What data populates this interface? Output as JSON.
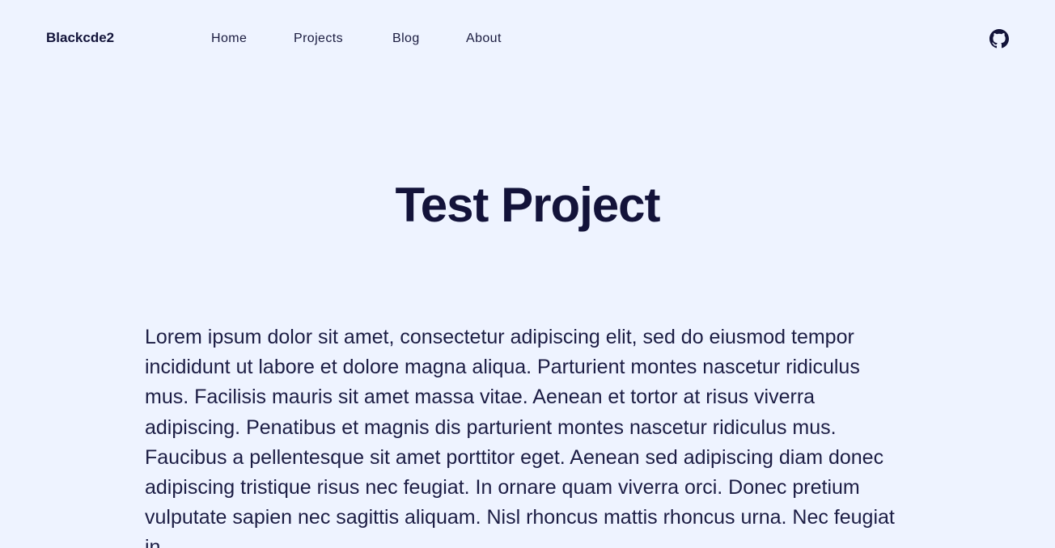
{
  "nav": {
    "brand": "Blackcde2",
    "links": [
      "Home",
      "Projects",
      "Blog",
      "About"
    ],
    "github_icon": "github-icon"
  },
  "page": {
    "title": "Test Project",
    "body": "Lorem ipsum dolor sit amet, consectetur adipiscing elit, sed do eiusmod tempor incididunt ut labore et dolore magna aliqua. Parturient montes nascetur ridiculus mus. Facilisis mauris sit amet massa vitae. Aenean et tortor at risus viverra adipiscing. Penatibus et magnis dis parturient montes nascetur ridiculus mus. Faucibus a pellentesque sit amet porttitor eget. Aenean sed adipiscing diam donec adipiscing tristique risus nec feugiat. In ornare quam viverra orci. Donec pretium vulputate sapien nec sagittis aliquam. Nisl rhoncus mattis rhoncus urna. Nec feugiat in"
  },
  "colors": {
    "background": "#eef3ff",
    "text": "#13143a"
  }
}
